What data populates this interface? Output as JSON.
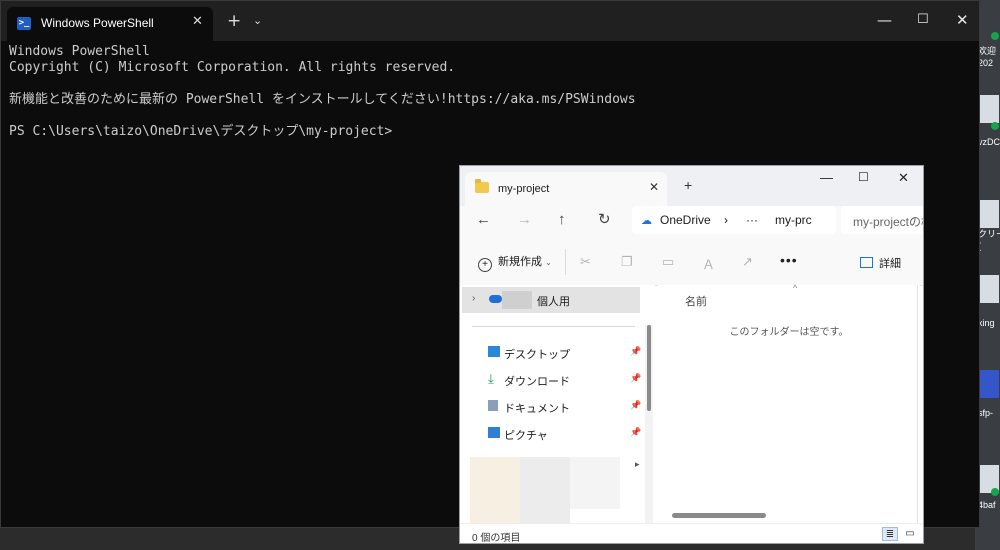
{
  "terminal": {
    "tab_title": "Windows PowerShell",
    "icon": "powershell-icon",
    "lines": [
      "Windows PowerShell",
      "Copyright (C) Microsoft Corporation. All rights reserved.",
      "",
      "新機能と改善のために最新の PowerShell をインストールしてください!https://aka.ms/PSWindows",
      "",
      "PS C:\\Users\\taizo\\OneDrive\\デスクトップ\\my-project>"
    ]
  },
  "explorer": {
    "tab_title": "my-project",
    "address": {
      "root": "OneDrive",
      "ellipsis": "···",
      "current": "my-prc"
    },
    "search_placeholder": "my-projectの検索",
    "toolbar": {
      "new_label": "新規作成",
      "details_label": "詳細"
    },
    "sidebar": {
      "personal_label": "個人用",
      "quick_access": [
        {
          "label": "デスクトップ",
          "icon": "desktop-icon",
          "color": "#2b88d8"
        },
        {
          "label": "ダウンロード",
          "icon": "download-icon",
          "color": "#1a9e54"
        },
        {
          "label": "ドキュメント",
          "icon": "document-icon",
          "color": "#7a8a9a"
        },
        {
          "label": "ピクチャ",
          "icon": "picture-icon",
          "color": "#2f7fd4"
        }
      ]
    },
    "content": {
      "column_name": "名前",
      "empty_message": "このフォルダーは空です。"
    },
    "status": "0 個の項目"
  },
  "desktop": {
    "labels": [
      "欢迎",
      "202",
      "vzDC",
      "クリー",
      "(",
      "king",
      "sfp-",
      "4baf"
    ]
  }
}
